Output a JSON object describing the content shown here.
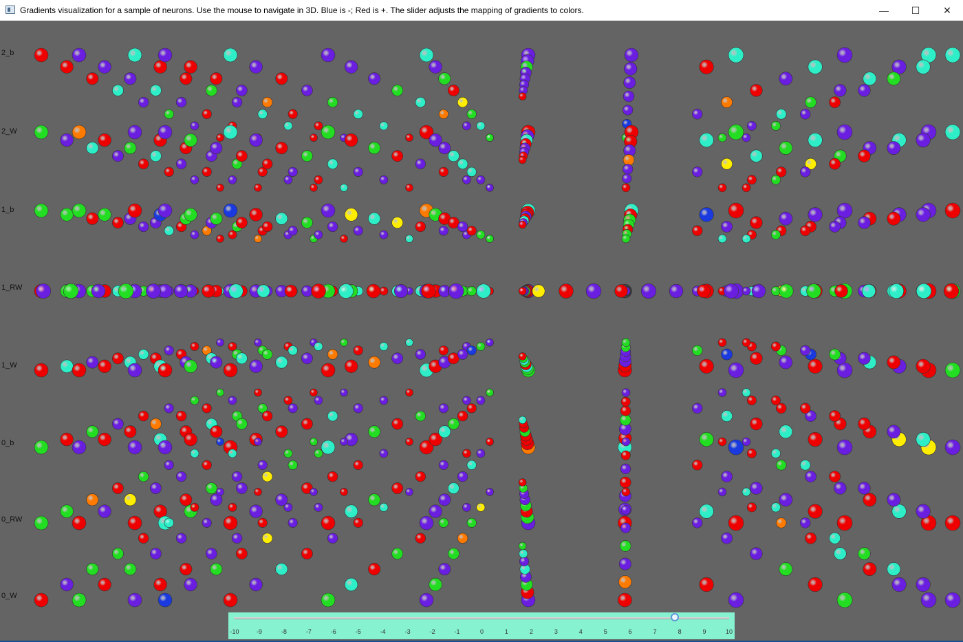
{
  "window": {
    "title": "Gradients visualization for a sample of neurons.  Use the mouse to navigate in 3D.  Blue is -; Red is +.  The slider adjusts the mapping of gradients to colors.",
    "minimize_icon": "minimize-icon",
    "maximize_icon": "maximize-icon",
    "close_icon": "close-icon"
  },
  "row_labels": [
    "2_b",
    "2_W",
    "1_b",
    "1_RW",
    "1_W",
    "0_b",
    "0_RW",
    "0_W"
  ],
  "slider": {
    "tick_labels": [
      "-10",
      "-9",
      "-8",
      "-7",
      "-6",
      "-5",
      "-4",
      "-3",
      "-2",
      "-1",
      "0",
      "1",
      "2",
      "3",
      "4",
      "5",
      "6",
      "7",
      "8",
      "9",
      "10"
    ],
    "min": -10,
    "max": 10,
    "value": 7.8
  },
  "colors": {
    "background": "#646464",
    "blue": "#6a1fe0",
    "red": "#ee0000",
    "green": "#22dd22",
    "cyan": "#2eeec8",
    "slider_bg": "#86f2d0"
  }
}
